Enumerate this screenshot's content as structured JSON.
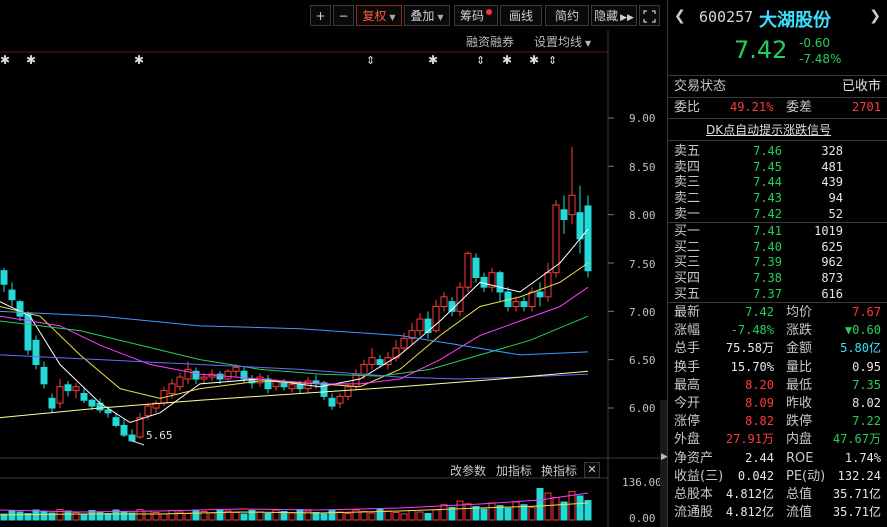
{
  "toolbar": {
    "plus": "+",
    "minus": "−",
    "fuquan": "复权",
    "diejia": "叠加",
    "chouma": "筹码",
    "huaxian": "画线",
    "jianyue": "简约",
    "yincang": "隐藏"
  },
  "sub_links": {
    "rongzi": "融资融券",
    "shezhi": "设置均线"
  },
  "price_axis": [
    "9.00",
    "8.50",
    "8.00",
    "7.50",
    "7.00",
    "6.50",
    "6.00"
  ],
  "volume_axis": [
    "136.00",
    "0.00"
  ],
  "low_marker": "5.65",
  "indicator_links": {
    "gaicanshu": "改参数",
    "jiazhibiao": "加指标",
    "huanzhibiao": "换指标"
  },
  "stock": {
    "code": "600257",
    "name": "大湖股份",
    "price": "7.42",
    "change": "-0.60",
    "change_pct": "-7.48%"
  },
  "status": {
    "label": "交易状态",
    "value": "已收市"
  },
  "weibi": {
    "label": "委比",
    "value": "49.21%",
    "label2": "委差",
    "value2": "2701"
  },
  "dk_link": "DK点自动提示涨跌信号",
  "asks": [
    {
      "label": "卖五",
      "price": "7.46",
      "vol": "328"
    },
    {
      "label": "卖四",
      "price": "7.45",
      "vol": "481"
    },
    {
      "label": "卖三",
      "price": "7.44",
      "vol": "439"
    },
    {
      "label": "卖二",
      "price": "7.43",
      "vol": "94"
    },
    {
      "label": "卖一",
      "price": "7.42",
      "vol": "52"
    }
  ],
  "bids": [
    {
      "label": "买一",
      "price": "7.41",
      "vol": "1019"
    },
    {
      "label": "买二",
      "price": "7.40",
      "vol": "625"
    },
    {
      "label": "买三",
      "price": "7.39",
      "vol": "962"
    },
    {
      "label": "买四",
      "price": "7.38",
      "vol": "873"
    },
    {
      "label": "买五",
      "price": "7.37",
      "vol": "616"
    }
  ],
  "quote": [
    {
      "l1": "最新",
      "v1": "7.42",
      "c1": "green",
      "l2": "均价",
      "v2": "7.67",
      "c2": "red"
    },
    {
      "l1": "涨幅",
      "v1": "-7.48%",
      "c1": "green",
      "l2": "涨跌",
      "v2": "▼0.60",
      "c2": "green"
    },
    {
      "l1": "总手",
      "v1": "75.58万",
      "c1": "white",
      "l2": "金额",
      "v2": "5.80亿",
      "c2": "cyan"
    },
    {
      "l1": "换手",
      "v1": "15.70%",
      "c1": "white",
      "l2": "量比",
      "v2": "0.95",
      "c2": "white"
    },
    {
      "l1": "最高",
      "v1": "8.20",
      "c1": "red",
      "l2": "最低",
      "v2": "7.35",
      "c2": "green"
    },
    {
      "l1": "今开",
      "v1": "8.09",
      "c1": "red",
      "l2": "昨收",
      "v2": "8.02",
      "c2": "white"
    },
    {
      "l1": "涨停",
      "v1": "8.82",
      "c1": "red",
      "l2": "跌停",
      "v2": "7.22",
      "c2": "green"
    },
    {
      "l1": "外盘",
      "v1": "27.91万",
      "c1": "red",
      "l2": "内盘",
      "v2": "47.67万",
      "c2": "green"
    },
    {
      "l1": "净资产",
      "v1": "2.44",
      "c1": "white",
      "l2": "ROE",
      "v2": "1.74%",
      "c2": "white"
    },
    {
      "l1": "收益(三)",
      "v1": "0.042",
      "c1": "white",
      "l2": "PE(动)",
      "v2": "132.24",
      "c2": "white"
    },
    {
      "l1": "总股本",
      "v1": "4.812亿",
      "c1": "white",
      "l2": "总值",
      "v2": "35.71亿",
      "c2": "white"
    },
    {
      "l1": "流通股",
      "v1": "4.812亿",
      "c1": "white",
      "l2": "流值",
      "v2": "35.71亿",
      "c2": "white"
    }
  ],
  "colors": {
    "up": "#ff3b3b",
    "down": "#24d05a",
    "flat": "#ffffff",
    "ma5": "#ffffff",
    "ma10": "#f0e04a",
    "ma20": "#ff3cff",
    "ma30": "#24d05a",
    "ma60": "#3c9cff",
    "ma120": "#ffff99"
  }
}
